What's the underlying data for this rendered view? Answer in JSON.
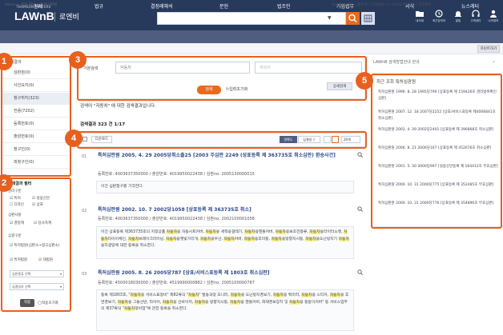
{
  "header": {
    "logo_sub": "THOMSON REUTERS",
    "logo": "LAWnB",
    "logo_kr": "로엔비",
    "search_placeholder": "",
    "icons": [
      {
        "name": "folder-icon",
        "label": "내서재"
      },
      {
        "name": "history-icon",
        "label": "최근검색어"
      },
      {
        "name": "bell-icon",
        "label": "알림"
      },
      {
        "name": "headset-icon",
        "label": "고객센터"
      },
      {
        "name": "user-icon",
        "label": "나의정보"
      }
    ]
  },
  "nav": [
    "판례",
    "법규",
    "결정례해석",
    "문헌",
    "법조인",
    "기업법무",
    "서식",
    "뉴스레터"
  ],
  "breadcrumb": "Home > 결정·해석 > 특허심판원",
  "breadcrumb_right": "Searched by | 정회원 | 기업회원 | (~2016-06-22) | 고객센터",
  "print_label": "프린트하기",
  "left_panel": {
    "title": "검색결과",
    "items": [
      {
        "label": "심판원(0)",
        "active": false
      },
      {
        "label": "사건요지(0)",
        "active": false
      },
      {
        "label": "청구취지(323)",
        "active": true
      },
      {
        "label": "전용(7202)",
        "active": false
      },
      {
        "label": "등록번호(0)",
        "active": false
      },
      {
        "label": "출원번호(0)",
        "active": false
      },
      {
        "label": "청구인(0)",
        "active": false
      },
      {
        "label": "피청구인(0)",
        "active": false
      }
    ]
  },
  "filter_panel": {
    "title": "검색결과 필터",
    "group1_title": "권리구분",
    "group1_opts": [
      "특허",
      "실용신안",
      "디자인",
      "상표"
    ],
    "group2_title": "심판사항",
    "group2_opts": [
      "결정계",
      "당사자계"
    ],
    "group3_title": "심결구분",
    "group3_opts": [
      "특허법원(심판소+항고심판소)",
      "특허법원",
      "대법원"
    ],
    "select1": "심판종류 선택",
    "select2": "심결일자 선택",
    "apply": "적용",
    "reset": "적용초기화"
  },
  "form": {
    "label": "기본검색",
    "kw1": "자동차",
    "kw2": "제외어",
    "detail": "상세검색",
    "search": "검색",
    "reset": "입력초기화"
  },
  "summary": "검색어 \"자동차\" 에 대한 검색결과입니다.",
  "result_count": "검색결과 323 건 1/17",
  "toolbar": {
    "download": "다운로드",
    "sort_a": "정확도",
    "sort_b": "심결일 ▽",
    "per_page": "20개"
  },
  "results": [
    {
      "num": "01",
      "title": "특허심판원 2005. 4. 29 2005당취소출25 [2003 주심판 2249 (상표등록 제 363735호 취소심판) 환송사건]",
      "meta": "등록번호: 4003637350000 / 출원번호: 4019950022438 / 심판no: 2005130000015",
      "body": [
        {
          "t": "이건 심판청구를 기각한다.",
          "h": false
        }
      ]
    },
    {
      "num": "02",
      "title": "특허심판원 2002. 10. 7 2002당1058 [상표등록 제 363735호 취소]",
      "meta": "등록번호: 4003637350000 / 출원번호: 4019950022438 / 심판no: 2002100001058",
      "body": [
        {
          "t": "이건 상표등록 제363735호의 지정상품 ",
          "h": false
        },
        {
          "t": "자동차",
          "h": true
        },
        {
          "t": "용 자동시트커버, ",
          "h": false
        },
        {
          "t": "자동차",
          "h": true
        },
        {
          "t": "용 세척용걸레기, ",
          "h": false
        },
        {
          "t": "자동차",
          "h": true
        },
        {
          "t": "용핸들커버, ",
          "h": false
        },
        {
          "t": "자동차",
          "h": true
        },
        {
          "t": "용보조전등류, ",
          "h": false
        },
        {
          "t": "자동차",
          "h": true
        },
        {
          "t": "용라이터소켓, ",
          "h": false
        },
        {
          "t": "자동차",
          "h": true
        },
        {
          "t": "타이어체인, ",
          "h": false
        },
        {
          "t": "자동차",
          "h": true
        },
        {
          "t": "브레이크라이닝, ",
          "h": false
        },
        {
          "t": "자동차",
          "h": true
        },
        {
          "t": "용햇빛가리개, ",
          "h": false
        },
        {
          "t": "자동차",
          "h": true
        },
        {
          "t": "용우산, ",
          "h": false
        },
        {
          "t": "자동차",
          "h": true
        },
        {
          "t": "커버, ",
          "h": false
        },
        {
          "t": "자동차",
          "h": true
        },
        {
          "t": "용후미등, ",
          "h": false
        },
        {
          "t": "자동차",
          "h": true
        },
        {
          "t": "용방향지시등, ",
          "h": false
        },
        {
          "t": "자동차",
          "h": true
        },
        {
          "t": "용도난방지기 ",
          "h": false
        },
        {
          "t": "자동차",
          "h": true
        },
        {
          "t": "용차광망에 대한 등록을 취소한다.",
          "h": false
        }
      ]
    },
    {
      "num": "03",
      "title": "특허심판원 2005. 8. 26 2005당787 [상표/서비스표등록 제 1803호 취소심판]",
      "meta": "등록번호: 4500018030000 / 출원번호: 4519990000882 / 심판no: 2005100000787",
      "body": [
        {
          "t": "등록 제1803호, \"",
          "h": false
        },
        {
          "t": "자동차",
          "h": true
        },
        {
          "t": "용 서비스표정비\" 제82류의 \"",
          "h": false
        },
        {
          "t": "자동차",
          "h": true
        },
        {
          "t": "\" 발송과정 모니터, ",
          "h": false
        },
        {
          "t": "자동차",
          "h": true
        },
        {
          "t": "용 도난방지경보기, ",
          "h": false
        },
        {
          "t": "자동차",
          "h": true
        },
        {
          "t": "용 백미러, ",
          "h": false
        },
        {
          "t": "자동차",
          "h": true
        },
        {
          "t": "용 스티커, ",
          "h": false
        },
        {
          "t": "자동차",
          "h": true
        },
        {
          "t": "용 후면경보기, ",
          "h": false
        },
        {
          "t": "자동차",
          "h": true
        },
        {
          "t": "용 그물선반, 타이어, ",
          "h": false
        },
        {
          "t": "자동차",
          "h": true
        },
        {
          "t": "용 선바이저, ",
          "h": false
        },
        {
          "t": "자동차",
          "h": true
        },
        {
          "t": "용 방향지시등, ",
          "h": false
        },
        {
          "t": "자동차",
          "h": true
        },
        {
          "t": "용 핸들커버, 화재경보장치 및 ",
          "h": false
        },
        {
          "t": "자동차",
          "h": true
        },
        {
          "t": "용 등받이커버\" 등 서비스업무의 제37류의 \"",
          "h": false
        },
        {
          "t": "자동차",
          "h": true
        },
        {
          "t": "정비업\"에 관한 등록을 취소한다.",
          "h": false
        }
      ]
    }
  ],
  "right_panel": {
    "head": "LAWnB 검색방법안내 안내",
    "title": "최근 조회 특허심판원",
    "items": [
      "특허심판원 1996. 8. 28 1995당790 [상표등록 제 159426호 권리범위확인심판]",
      "특허심판원 2007. 12. 18 2007당2252 [상표/서비스표등록 제4006841호 취소심판]",
      "특허심판원 2003. 4. 29 2002당2401 [상표등록 제 396868호 취소심판]",
      "특허심판원 2006. 8. 21 2006당167 [상표등록 제 452676호 취소심판]",
      "특허심판원 2001. 5. 30 2000당997 [실용신안등록 제 164412호 무효심판]",
      "특허심판원 2000. 10. 31 2000당775 [상표등록 제 352485호 무효심판]",
      "특허심판원 2000. 10. 31 2000당776 [상표등록 제 354890호 무효심판]"
    ]
  },
  "callouts": [
    "1",
    "2",
    "3",
    "4",
    "5"
  ],
  "colors": {
    "navy": "#273a5c",
    "accent": "#e86a1f",
    "highlight": "#fbf089",
    "callout": "#e8601e"
  }
}
